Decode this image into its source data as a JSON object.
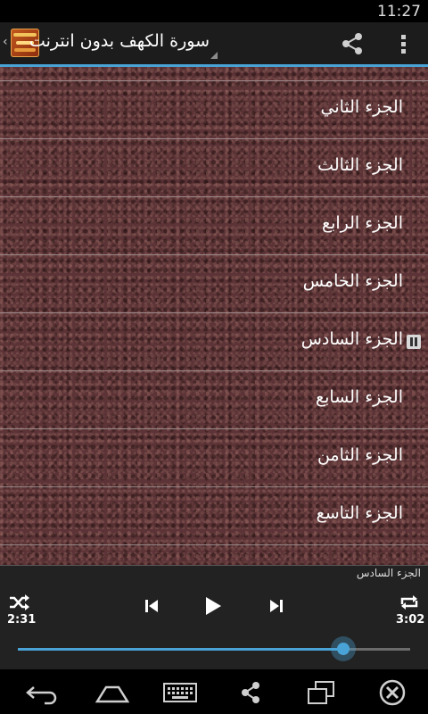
{
  "status_bar": {
    "time": "11:27"
  },
  "action_bar": {
    "title": "سورة الكهف بدون انترنت",
    "icons": [
      "app-icon",
      "share-icon",
      "overflow-icon"
    ]
  },
  "list": {
    "items": [
      {
        "label": "الجزء الثاني",
        "playing": false
      },
      {
        "label": "الجزء الثالث",
        "playing": false
      },
      {
        "label": "الجزء الرابع",
        "playing": false
      },
      {
        "label": "الجزء الخامس",
        "playing": false
      },
      {
        "label": "الجزء السادس",
        "playing": true
      },
      {
        "label": "الجزء السابع",
        "playing": false
      },
      {
        "label": "الجزء الثامن",
        "playing": false
      },
      {
        "label": "الجزء التاسع",
        "playing": false
      }
    ]
  },
  "player": {
    "now_playing": "الجزء السادس",
    "elapsed": "2:31",
    "duration": "3:02",
    "progress_fraction": 0.83,
    "accent_color": "#4aa3d6"
  },
  "nav_bar": {
    "icons": [
      "back-icon",
      "home-icon",
      "keyboard-icon",
      "share-icon",
      "recent-apps-icon",
      "close-icon"
    ]
  }
}
